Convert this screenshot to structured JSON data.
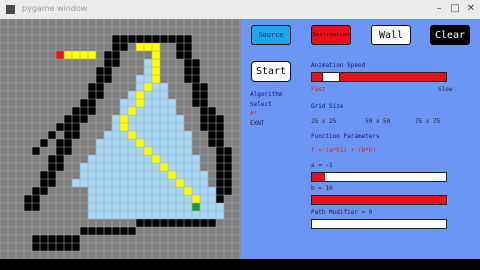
{
  "window": {
    "title": "pygame window"
  },
  "toolbar": {
    "source_label": "Source",
    "destination_label": "Destination",
    "wall_label": "Wall",
    "clear_label": "Clear",
    "start_label": "Start"
  },
  "algorithm": {
    "title": "Algorithm",
    "title2": "Select",
    "options": [
      "A*",
      "EXNT"
    ]
  },
  "animation": {
    "label": "Animation Speed",
    "fast": "Fast",
    "slow": "Slow",
    "value": 0.09
  },
  "grid_size": {
    "label": "Grid Size",
    "options": [
      "25 x 25",
      "50 x 50",
      "75 x 75"
    ]
  },
  "function": {
    "label": "Function Parameters",
    "formula": "f = (a*h1) + (b*h)",
    "a_label": "a = -1",
    "a_value": 0.1,
    "b_label": "b = 10",
    "b_value": 1.0,
    "modifier_label": "Path Modifier = 0",
    "modifier_value": 0
  },
  "colors": {
    "empty": "#7f7f7f",
    "wall": "#000000",
    "visited": "#a6d6f5",
    "path": "#ffff00",
    "source": "#e8101a",
    "destination": "#19a02a",
    "panel": "#6b96f4",
    "gridline": "#a9a9a9"
  }
}
